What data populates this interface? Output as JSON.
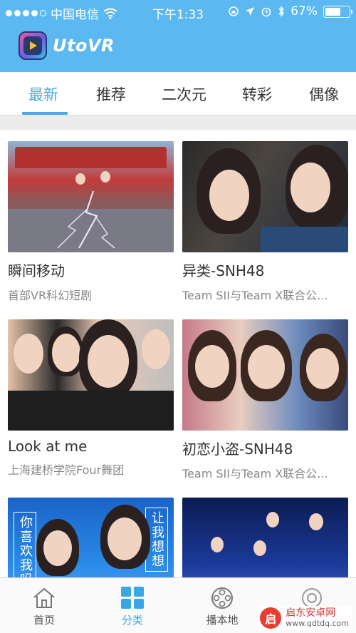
{
  "status_bar": {
    "carrier": "中国电信",
    "time": "下午1:33",
    "battery_percent": "67%",
    "battery_level": 0.67,
    "signal_bars": 4
  },
  "app": {
    "name": "UtoVR"
  },
  "tabs": [
    {
      "label": "最新",
      "active": true
    },
    {
      "label": "推荐",
      "active": false
    },
    {
      "label": "二次元",
      "active": false
    },
    {
      "label": "转彩",
      "active": false
    },
    {
      "label": "偶像",
      "active": false
    }
  ],
  "videos": [
    {
      "title": "瞬间移动",
      "subtitle": "首部VR科幻短剧"
    },
    {
      "title": "异类-SNH48",
      "subtitle": "Team SII与Team X联合公..."
    },
    {
      "title": "Look at me",
      "subtitle": "上海建桥学院Four舞团"
    },
    {
      "title": "初恋小盗-SNH48",
      "subtitle": "Team SII与Team X联合公..."
    },
    {
      "title": "",
      "subtitle": "",
      "thumb_text_left": "你喜欢我吗",
      "thumb_text_right": "让我想想"
    },
    {
      "title": "",
      "subtitle": ""
    }
  ],
  "bottom_nav": [
    {
      "label": "首页",
      "icon": "home-icon",
      "active": false
    },
    {
      "label": "分类",
      "icon": "grid-icon",
      "active": true
    },
    {
      "label": "播本地",
      "icon": "film-reel-icon",
      "active": false
    },
    {
      "label": "",
      "icon": "profile-icon",
      "active": false
    }
  ],
  "watermark": {
    "mark": "启",
    "text": "启东安卓网",
    "url": "www.qdtdq.com"
  },
  "colors": {
    "header": "#5bb8f0",
    "accent": "#4ea9e0"
  }
}
